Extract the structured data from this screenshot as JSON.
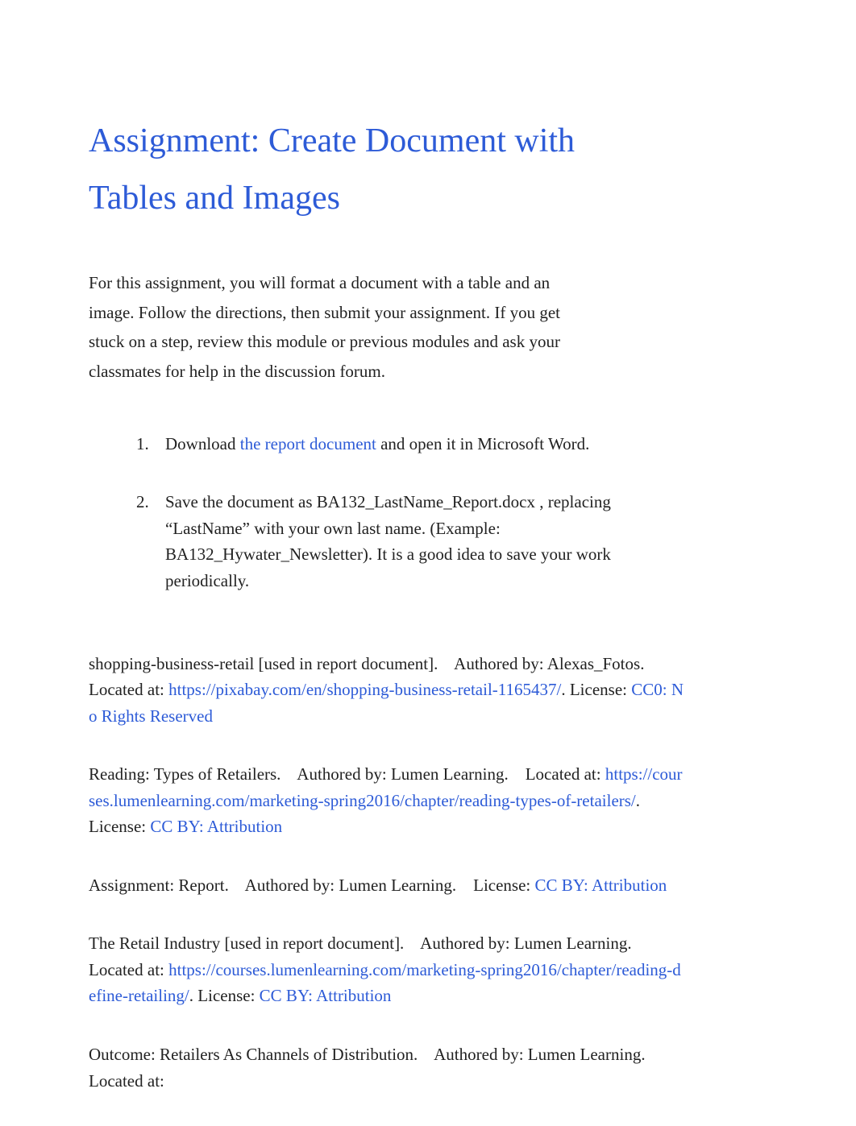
{
  "title": "Assignment: Create Document with Tables and Images",
  "intro": "For this assignment, you will format a document with a table and an image. Follow the directions, then submit your assignment. If you get stuck on a step, review this module or previous modules and ask your classmates for help in the discussion forum.",
  "steps": {
    "s1_before": "Download ",
    "s1_link": "the report document",
    "s1_after": " and open it in Microsoft Word.",
    "s2_before": "Save the document as ",
    "s2_file": "BA132_LastName_Report.docx",
    "s2_after": ", replacing “LastName” with your own last name. (Example: BA132_Hywater_Newsletter). It is a good idea to save your work periodically."
  },
  "refs": {
    "r1": {
      "name": "shopping-business-retail [used in report document].",
      "auth_label": "Authored by",
      "auth": "Alexas_Fotos.",
      "loc_label": "Located at",
      "loc_url": "https://pixabay.com/en/shopping-business-retail-1165437/",
      "lic_label": "License",
      "lic": "CC0: No Rights Reserved"
    },
    "r2": {
      "name": "Reading: Types of Retailers.",
      "auth_label": "Authored by",
      "auth": "Lumen Learning.",
      "loc_label": "Located at",
      "loc_url": "https://courses.lumenlearning.com/marketing-spring2016/chapter/reading-types-of-retailers/",
      "lic_label": "License",
      "lic": "CC BY: Attribution"
    },
    "r3": {
      "name": "Assignment: Report.",
      "auth_label": "Authored by",
      "auth": "Lumen Learning.",
      "lic_label": "License",
      "lic": "CC BY: Attribution"
    },
    "r4": {
      "name": "The Retail Industry [used in report document].",
      "auth_label": "Authored by",
      "auth": "Lumen Learning.",
      "loc_label": "Located at",
      "loc_url": "https://courses.lumenlearning.com/marketing-spring2016/chapter/reading-define-retailing/",
      "lic_label": "License",
      "lic": "CC BY: Attribution"
    },
    "r5": {
      "name": "Outcome: Retailers As Channels of Distribution.",
      "auth_label": "Authored by",
      "auth": "Lumen Learning.",
      "loc_label": "Located at"
    }
  },
  "sep": {
    "colon": ": ",
    "colon_tight": ":",
    "period": ". ",
    "period_tight": "."
  }
}
